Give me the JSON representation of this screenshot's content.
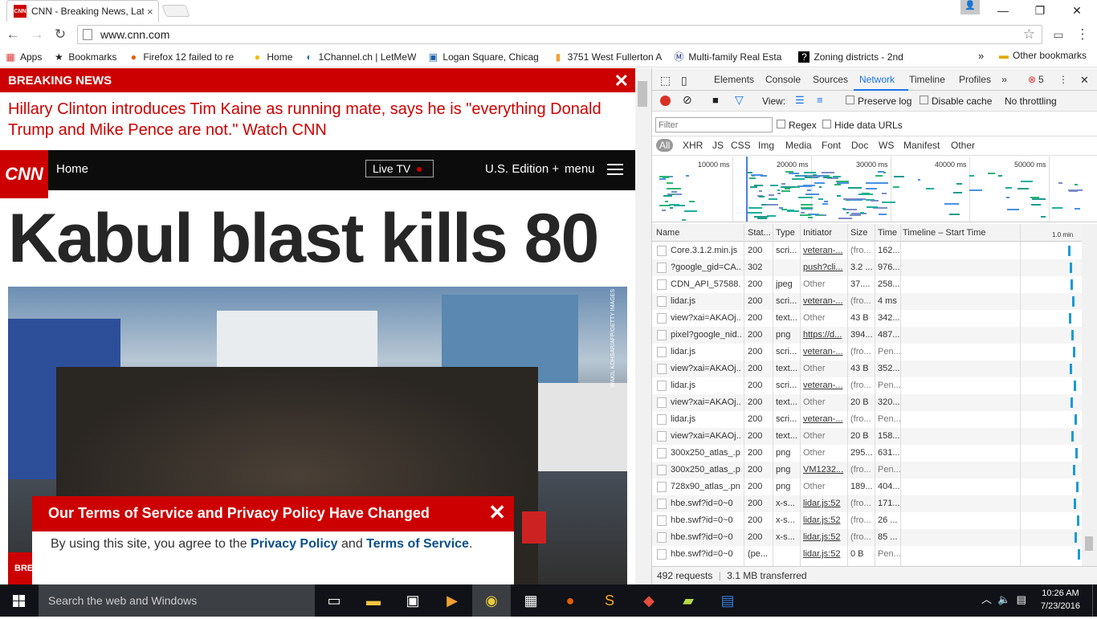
{
  "browser": {
    "tab_title": "CNN - Breaking News, Lat",
    "tab_close": "×",
    "url": "www.cnn.com",
    "bookmarks": [
      {
        "icon": "apps-icon",
        "label": "Apps"
      },
      {
        "icon": "star-icon",
        "label": "Bookmarks"
      },
      {
        "icon": "firefox-icon",
        "label": "Firefox 12 failed to re"
      },
      {
        "icon": "home-icon",
        "label": "Home"
      },
      {
        "icon": "1channel-icon",
        "label": "1Channel.ch | LetMeW"
      },
      {
        "icon": "map-icon",
        "label": "Logan Square, Chicag"
      },
      {
        "icon": "house-icon",
        "label": "3751 West Fullerton A"
      },
      {
        "icon": "realestate-icon",
        "label": "Multi-family Real Esta"
      },
      {
        "icon": "zoning-icon",
        "label": "Zoning districts - 2nd"
      }
    ],
    "bookmarks_overflow": "»",
    "other_bookmarks": "Other bookmarks"
  },
  "page": {
    "breaking_label": "BREAKING NEWS",
    "breaking_text": "Hillary Clinton introduces Tim Kaine as running mate, says he is \"everything Donald Trump and Mike Pence are not.\" Watch CNN",
    "logo": "CNN",
    "nav_home": "Home",
    "live_tv": "Live TV",
    "edition": "U.S. Edition +",
    "menu": "menu",
    "headline": "Kabul blast kills 80",
    "photo_credit": "WAKIL KOHSAR/AFP/GETTY IMAGES",
    "brk_tag": "BRE",
    "tos_title": "Our Terms of Service and Privacy Policy Have Changed",
    "tos_prefix": "By using this site, you agree to the",
    "tos_privacy": "Privacy Policy",
    "tos_and": "and",
    "tos_terms": "Terms of Service",
    "tos_suffix": "."
  },
  "devtools": {
    "tabs": [
      "Elements",
      "Console",
      "Sources",
      "Network",
      "Timeline",
      "Profiles"
    ],
    "active_tab": "Network",
    "more": "»",
    "error_count": "5",
    "view_label": "View:",
    "preserve_log": "Preserve log",
    "disable_cache": "Disable cache",
    "throttling": "No throttling",
    "filter_placeholder": "Filter",
    "regex": "Regex",
    "hide_data_urls": "Hide data URLs",
    "types": [
      "All",
      "XHR",
      "JS",
      "CSS",
      "Img",
      "Media",
      "Font",
      "Doc",
      "WS",
      "Manifest",
      "Other"
    ],
    "overview_labels": [
      "10000 ms",
      "20000 ms",
      "30000 ms",
      "40000 ms",
      "50000 ms"
    ],
    "columns": [
      "Name",
      "Stat...",
      "Type",
      "Initiator",
      "Size",
      "Time",
      "Timeline – Start Time",
      "1.0 min"
    ],
    "rows": [
      {
        "name": "Core.3.1.2.min.js",
        "status": "200",
        "type": "scri...",
        "initiator": "veteran-...",
        "size": "(fro...",
        "time": "162..."
      },
      {
        "name": "?google_gid=CA...",
        "status": "302",
        "type": "",
        "initiator": "push?cli...",
        "size": "3.2 ...",
        "time": "976..."
      },
      {
        "name": "CDN_API_57588...",
        "status": "200",
        "type": "jpeg",
        "initiator": "Other",
        "size": "37....",
        "time": "258..."
      },
      {
        "name": "lidar.js",
        "status": "200",
        "type": "scri...",
        "initiator": "veteran-...",
        "size": "(fro...",
        "time": "4 ms"
      },
      {
        "name": "view?xai=AKAOj...",
        "status": "200",
        "type": "text...",
        "initiator": "Other",
        "size": "43 B",
        "time": "342..."
      },
      {
        "name": "pixel?google_nid...",
        "status": "200",
        "type": "png",
        "initiator": "https://d...",
        "size": "394...",
        "time": "487..."
      },
      {
        "name": "lidar.js",
        "status": "200",
        "type": "scri...",
        "initiator": "veteran-...",
        "size": "(fro...",
        "time": "Pen..."
      },
      {
        "name": "view?xai=AKAOj...",
        "status": "200",
        "type": "text...",
        "initiator": "Other",
        "size": "43 B",
        "time": "352..."
      },
      {
        "name": "lidar.js",
        "status": "200",
        "type": "scri...",
        "initiator": "veteran-...",
        "size": "(fro...",
        "time": "Pen..."
      },
      {
        "name": "view?xai=AKAOj...",
        "status": "200",
        "type": "text...",
        "initiator": "Other",
        "size": "20 B",
        "time": "320..."
      },
      {
        "name": "lidar.js",
        "status": "200",
        "type": "scri...",
        "initiator": "veteran-...",
        "size": "(fro...",
        "time": "Pen..."
      },
      {
        "name": "view?xai=AKAOj...",
        "status": "200",
        "type": "text...",
        "initiator": "Other",
        "size": "20 B",
        "time": "158..."
      },
      {
        "name": "300x250_atlas_.p...",
        "status": "200",
        "type": "png",
        "initiator": "Other",
        "size": "295...",
        "time": "631..."
      },
      {
        "name": "300x250_atlas_.p...",
        "status": "200",
        "type": "png",
        "initiator": "VM1232...",
        "size": "(fro...",
        "time": "Pen..."
      },
      {
        "name": "728x90_atlas_.pn...",
        "status": "200",
        "type": "png",
        "initiator": "Other",
        "size": "189...",
        "time": "404..."
      },
      {
        "name": "hbe.swf?id=0~0",
        "status": "200",
        "type": "x-s...",
        "initiator": "lidar.js:52",
        "size": "(fro...",
        "time": "171..."
      },
      {
        "name": "hbe.swf?id=0~0",
        "status": "200",
        "type": "x-s...",
        "initiator": "lidar.js:52",
        "size": "(fro...",
        "time": "26 ..."
      },
      {
        "name": "hbe.swf?id=0~0",
        "status": "200",
        "type": "x-s...",
        "initiator": "lidar.js:52",
        "size": "(fro...",
        "time": "85 ..."
      },
      {
        "name": "hbe.swf?id=0~0",
        "status": "(pe...",
        "type": "",
        "initiator": "lidar.js:52",
        "size": "0 B",
        "time": "Pen..."
      }
    ],
    "requests": "492 requests",
    "transferred": "3.1 MB transferred"
  },
  "taskbar": {
    "search_placeholder": "Search the web and Windows",
    "time": "10:26 AM",
    "date": "7/23/2016"
  },
  "colors": {
    "cnn_red": "#cc0000",
    "devtools_blue": "#1a73e8"
  }
}
